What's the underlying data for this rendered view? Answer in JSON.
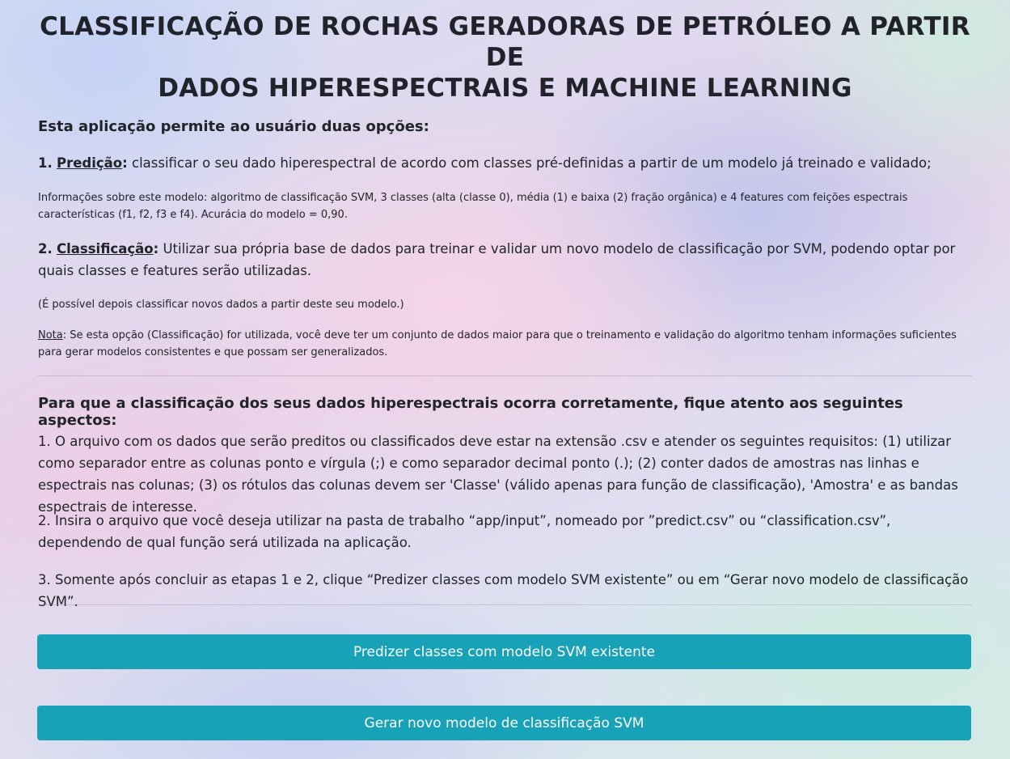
{
  "header": {
    "title_line1": "CLASSIFICAÇÃO DE ROCHAS GERADORAS DE PETRÓLEO A PARTIR DE",
    "title_line2": "DADOS HIPERESPECTRAIS E MACHINE LEARNING"
  },
  "intro": {
    "title": "Esta aplicação permite ao usuário duas opções:",
    "option1": {
      "number": "1.",
      "label": "Predição",
      "colon": ":",
      "text": " classificar o seu dado hiperespectral de acordo com classes pré-definidas a partir de um modelo já treinado e validado;"
    },
    "model_info": "Informações sobre este modelo: algoritmo de classificação SVM, 3 classes (alta (classe 0), média (1) e baixa (2) fração orgânica) e 4 features com feições espectrais características (f1, f2, f3 e f4). Acurácia do modelo = 0,90.",
    "option2": {
      "number": "2.",
      "label": "Classificação",
      "colon": ":",
      "text": " Utilizar sua própria base de dados para treinar e validar um novo modelo de classificação por SVM, podendo optar por quais classes e features serão utilizadas."
    },
    "possible_note": "(É possível depois classificar novos dados a partir deste seu modelo.)",
    "note": {
      "label": "Nota",
      "text": ": Se esta opção (Classificação) for utilizada, você deve ter um conjunto de dados maior para que o treinamento e validação do algoritmo tenham informações suficientes para gerar modelos consistentes e que possam ser generalizados."
    }
  },
  "aspects": {
    "title": "Para que a classificação dos seus dados hiperespectrais ocorra corretamente, fique atento aos seguintes aspectos:",
    "items": [
      "1. O arquivo com os dados que serão preditos ou classificados deve estar na extensão .csv e atender os seguintes requisitos: (1) utilizar como separador entre as colunas ponto e vírgula (;) e como separador decimal ponto (.); (2) conter dados de amostras nas linhas e espectrais nas colunas; (3) os rótulos das colunas devem ser 'Classe' (válido apenas para função de classificação), 'Amostra' e as bandas espectrais de interesse.",
      "2. Insira o arquivo que você deseja utilizar na pasta de trabalho “app/input”, nomeado por ”predict.csv” ou “classification.csv”, dependendo de qual função será utilizada na aplicação.",
      "3. Somente após concluir as etapas 1 e 2, clique “Predizer classes com modelo SVM existente” ou em “Gerar novo modelo de classificação SVM”."
    ]
  },
  "buttons": {
    "predict_label": "Predizer classes com modelo SVM existente",
    "generate_label": "Gerar novo modelo de classificação SVM"
  },
  "colors": {
    "button": "#17a2b8",
    "text": "#212529"
  }
}
